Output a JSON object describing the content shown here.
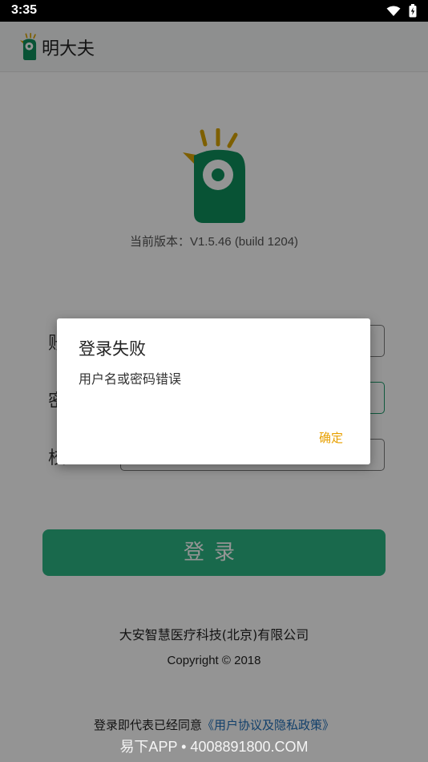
{
  "status_bar": {
    "time": "3:35",
    "icons": [
      "wifi-icon",
      "battery-charging-icon"
    ]
  },
  "app_bar": {
    "title": "明大夫"
  },
  "main": {
    "version": "当前版本：V1.5.46 (build 1204)",
    "form": {
      "label1": "账",
      "label2": "密",
      "label3": "校"
    },
    "login_button": "登录",
    "company": "大安智慧医疗科技(北京)有限公司",
    "copyright": "Copyright © 2018",
    "agreement_prefix": "登录即代表已经同意",
    "agreement_link": "《用户协议及隐私政策》"
  },
  "dialog": {
    "title": "登录失败",
    "message": "用户名或密码错误",
    "ok": "确定"
  },
  "watermark": "易下APP • 4008891800.COM",
  "colors": {
    "brand_green": "#2bb684",
    "logo_green": "#0f8f5c",
    "logo_yellow": "#d9a400",
    "dialog_accent": "#e8a000",
    "link_blue": "#1f6fb8"
  }
}
